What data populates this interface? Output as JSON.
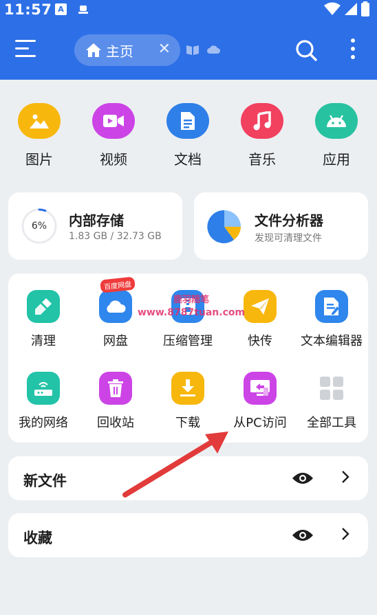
{
  "status_bar": {
    "time": "11:57",
    "icons": [
      "a-app-icon",
      "notification-icon",
      "wifi-icon",
      "signal-icon",
      "battery-icon"
    ]
  },
  "app_bar": {
    "active_tab": "主页",
    "buttons": [
      "menu-icon",
      "search-icon",
      "more-icon"
    ]
  },
  "categories": [
    {
      "label": "图片",
      "icon": "image-icon",
      "color": "#f8b70d"
    },
    {
      "label": "视频",
      "icon": "video-icon",
      "color": "#cc44e6"
    },
    {
      "label": "文档",
      "icon": "document-icon",
      "color": "#2f7fe8"
    },
    {
      "label": "音乐",
      "icon": "music-icon",
      "color": "#f2405f"
    },
    {
      "label": "应用",
      "icon": "android-icon",
      "color": "#27c2a0"
    }
  ],
  "storage": {
    "title": "内部存储",
    "usage": "1.83 GB / 32.73 GB",
    "percent_label": "6%",
    "percent": 6
  },
  "analyzer": {
    "title": "文件分析器",
    "subtitle": "发现可清理文件"
  },
  "tools": {
    "badge": "百度网盘",
    "watermark_line1": "鹿羽随笔",
    "watermark_line2": "www.8787tuan.com",
    "items": [
      {
        "label": "清理",
        "icon": "broom-icon",
        "color": "#22c3a7"
      },
      {
        "label": "网盘",
        "icon": "cloud-icon",
        "color": "#2f86ec"
      },
      {
        "label": "压缩管理",
        "icon": "zip-icon",
        "color": "#2f86ec"
      },
      {
        "label": "快传",
        "icon": "paper-plane-icon",
        "color": "#f8b70d"
      },
      {
        "label": "文本编辑器",
        "icon": "text-editor-icon",
        "color": "#2f86ec"
      },
      {
        "label": "我的网络",
        "icon": "router-icon",
        "color": "#22c3a7"
      },
      {
        "label": "回收站",
        "icon": "trash-icon",
        "color": "#cc44e6"
      },
      {
        "label": "下载",
        "icon": "download-icon",
        "color": "#f8b70d"
      },
      {
        "label": "从PC访问",
        "icon": "pc-access-icon",
        "color": "#cc44e6"
      },
      {
        "label": "全部工具",
        "icon": "grid-icon",
        "color": "#cfd3d8"
      }
    ]
  },
  "sections": [
    {
      "label": "新文件",
      "icon": "eye-icon"
    },
    {
      "label": "收藏",
      "icon": "eye-icon"
    }
  ],
  "annotation": {
    "type": "red-arrow",
    "points_to": "从PC访问"
  }
}
